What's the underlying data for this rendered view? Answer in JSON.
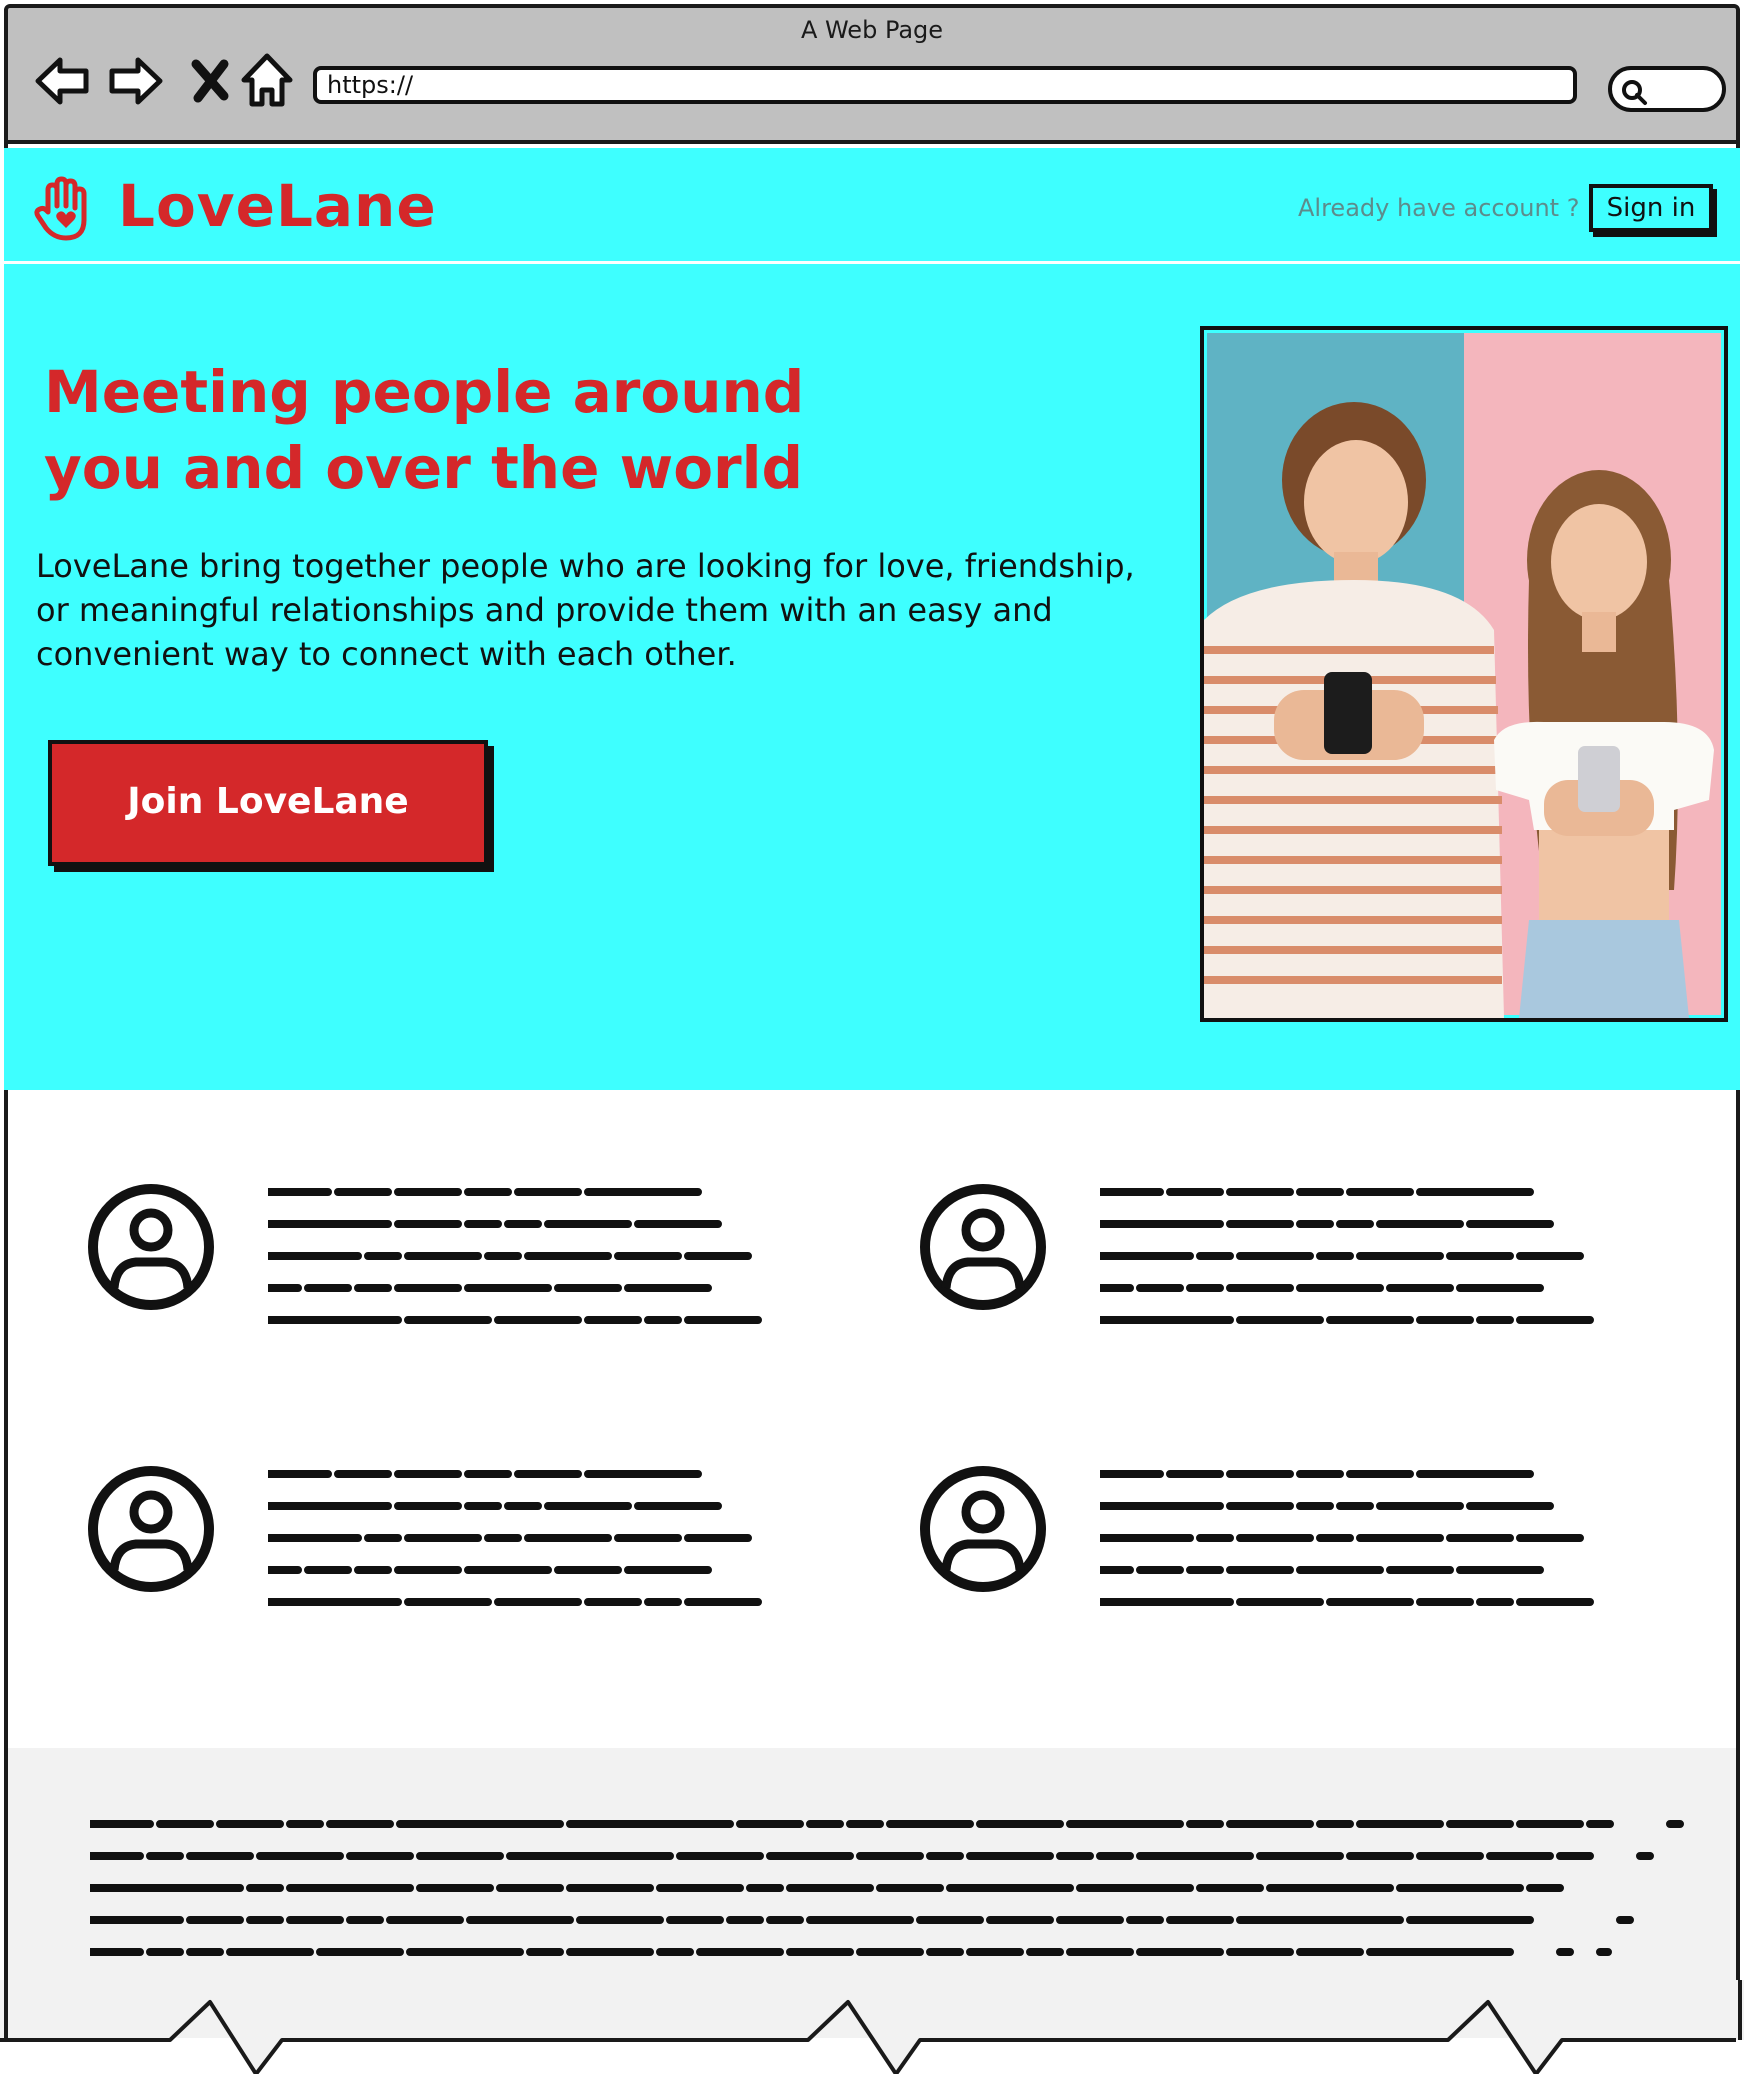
{
  "browser": {
    "window_title": "A Web Page",
    "url": "https://",
    "nav_icons": [
      "back-arrow-icon",
      "forward-arrow-icon",
      "close-icon",
      "home-icon"
    ],
    "search_icon": "search-icon"
  },
  "header": {
    "brand": "LoveLane",
    "logo_icon": "hand-heart-icon",
    "account_prompt": "Already have account ?",
    "signin_label": "Sign in"
  },
  "hero": {
    "headline_line1": "Meeting people around",
    "headline_line2": "you and over the world",
    "body": "LoveLane bring together people who are looking for love, friendship, or meaningful relationships and provide them with an easy and convenient way to connect with each other.",
    "cta_label": "Join LoveLane",
    "image": "couple-with-phones-photo"
  },
  "features": [
    {
      "icon": "user-avatar-icon",
      "text": "scribbled placeholder text"
    },
    {
      "icon": "user-avatar-icon",
      "text": "scribbled placeholder text"
    },
    {
      "icon": "user-avatar-icon",
      "text": "scribbled placeholder text"
    },
    {
      "icon": "user-avatar-icon",
      "text": "scribbled placeholder text"
    }
  ],
  "footer": {
    "text": "scribbled placeholder text"
  },
  "colors": {
    "accent_cyan": "#3effff",
    "brand_red": "#d4282a",
    "chrome_gray": "#c0c0c0",
    "footer_gray": "#f2f2f2"
  }
}
